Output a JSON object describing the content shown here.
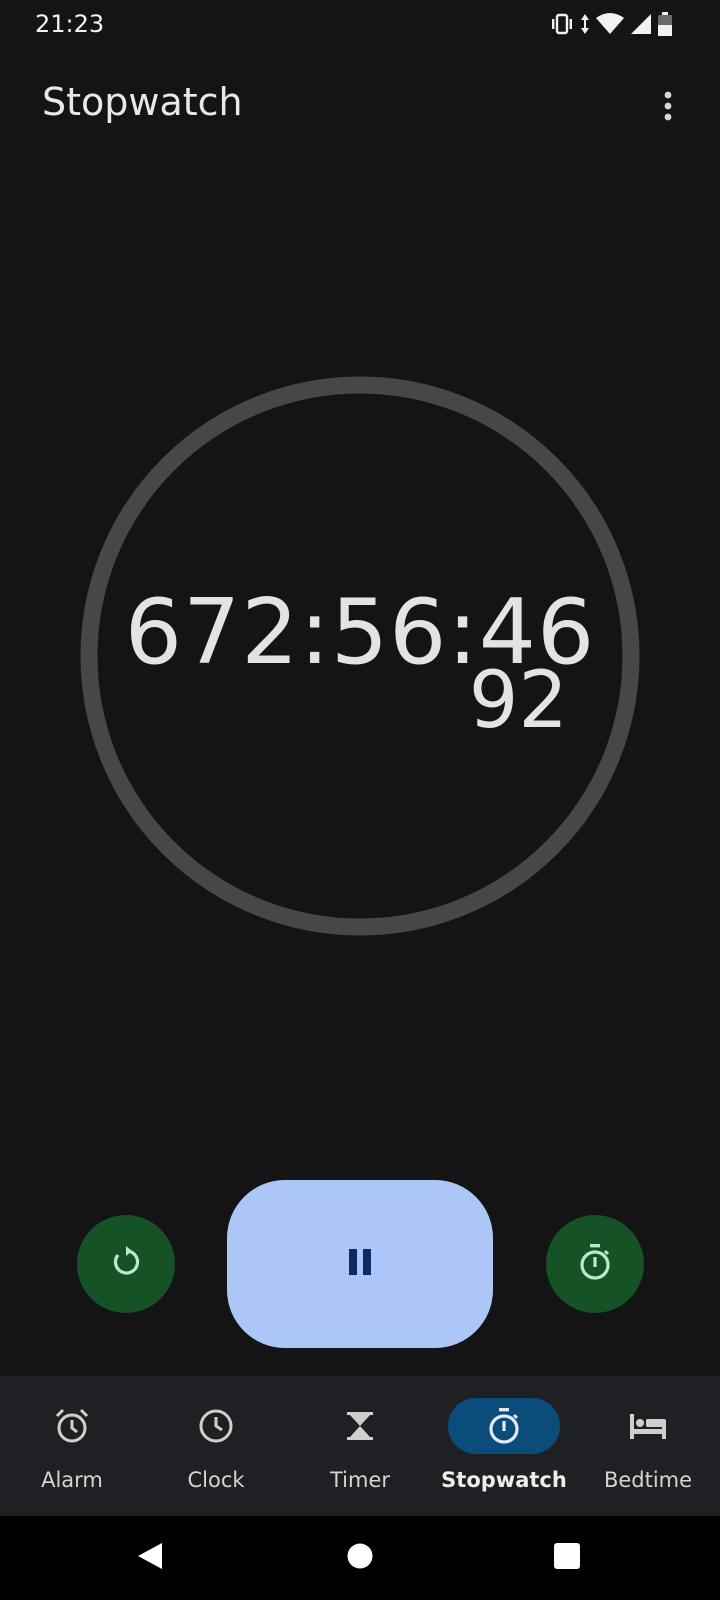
{
  "status_bar": {
    "time": "21:23",
    "icons": [
      "vibrate-icon",
      "data-transfer-icon",
      "wifi-icon",
      "cellular-signal-icon",
      "battery-icon"
    ]
  },
  "app_bar": {
    "title": "Stopwatch",
    "menu_icon": "more-vert-icon"
  },
  "stopwatch": {
    "elapsed_main": "672:56:46",
    "elapsed_hundredths": "92",
    "ring_color": "#464847"
  },
  "controls": {
    "reset_icon": "reset-icon",
    "pause_icon": "pause-icon",
    "lap_icon": "lap-timer-icon",
    "secondary_color": "#155225",
    "primary_color": "#adc6f8"
  },
  "bottom_nav": {
    "items": [
      {
        "label": "Alarm",
        "icon": "alarm-icon",
        "active": false
      },
      {
        "label": "Clock",
        "icon": "clock-icon",
        "active": false
      },
      {
        "label": "Timer",
        "icon": "hourglass-icon",
        "active": false
      },
      {
        "label": "Stopwatch",
        "icon": "stopwatch-icon",
        "active": true
      },
      {
        "label": "Bedtime",
        "icon": "bed-icon",
        "active": false
      }
    ],
    "active_indicator_color": "#0a4d7a"
  },
  "system_nav": {
    "buttons": [
      "back-icon",
      "home-icon",
      "recents-icon"
    ]
  }
}
